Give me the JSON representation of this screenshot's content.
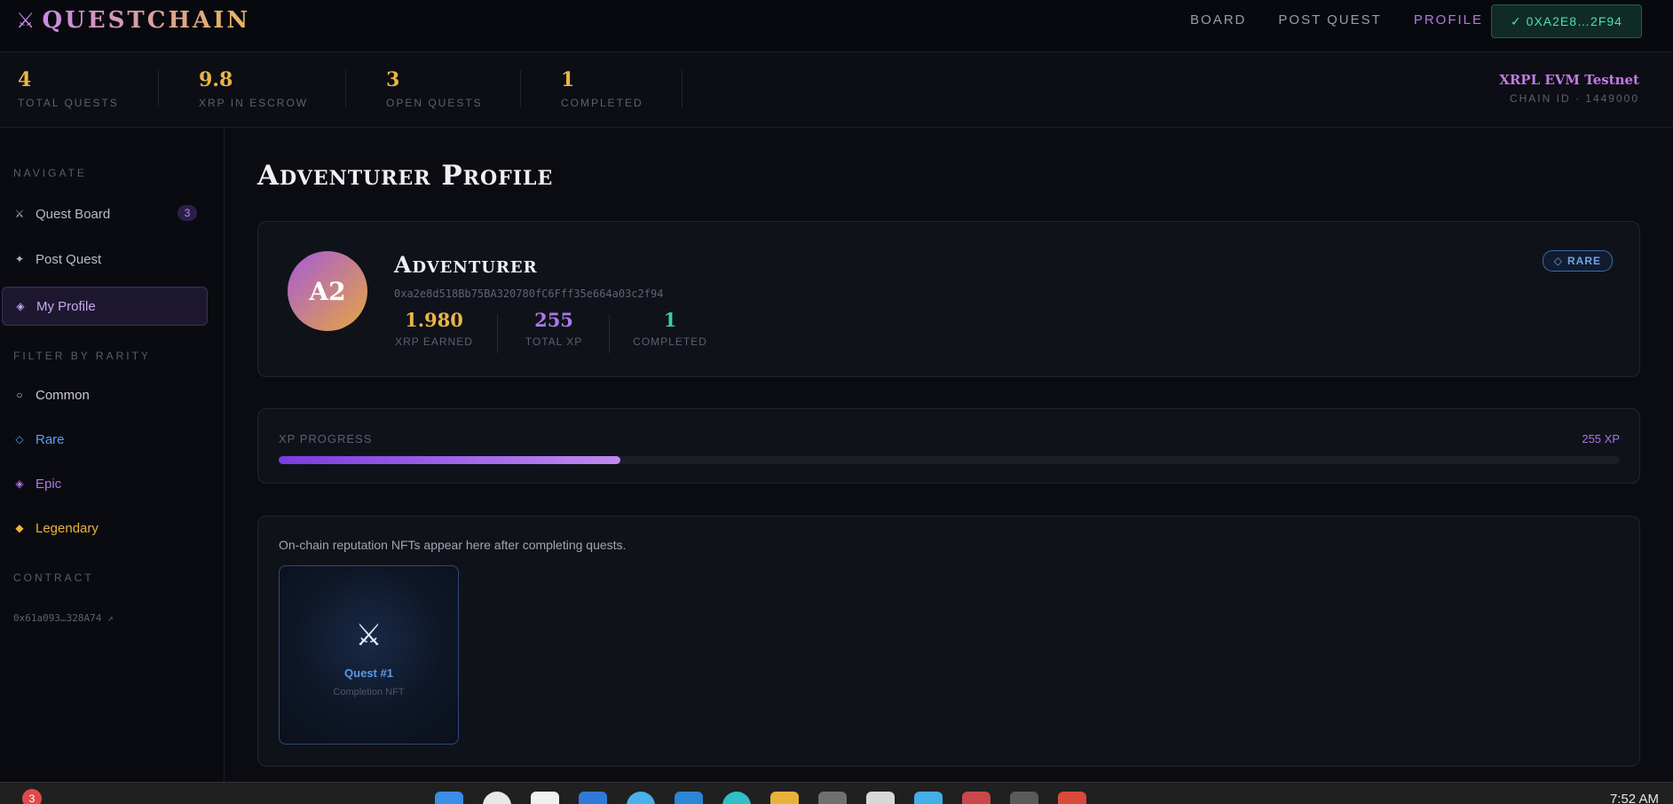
{
  "app": {
    "logo_icon": "⚔",
    "logo_text": "QUESTCHAIN"
  },
  "nav": {
    "links": [
      "BOARD",
      "POST QUEST",
      "PROFILE"
    ],
    "active_link": "PROFILE",
    "wallet": "✓ 0XA2E8…2F94"
  },
  "stats": [
    {
      "value": "4",
      "label": "TOTAL QUESTS"
    },
    {
      "value": "9.8",
      "label": "XRP IN ESCROW"
    },
    {
      "value": "3",
      "label": "OPEN QUESTS"
    },
    {
      "value": "1",
      "label": "COMPLETED"
    }
  ],
  "network": {
    "name": "XRPL EVM Testnet",
    "chain": "CHAIN ID · 1449000"
  },
  "sidebar": {
    "navigate_heading": "NAVIGATE",
    "items": [
      {
        "icon": "⚔",
        "label": "Quest Board",
        "badge": "3"
      },
      {
        "icon": "✦",
        "label": "Post Quest"
      },
      {
        "icon": "◈",
        "label": "My Profile"
      }
    ],
    "rarity_heading": "FILTER BY RARITY",
    "rarities": [
      {
        "icon": "○",
        "label": "Common",
        "color": "#c9cad3"
      },
      {
        "icon": "◇",
        "label": "Rare",
        "color": "#5c9cf0"
      },
      {
        "icon": "◈",
        "label": "Epic",
        "color": "#b276e8"
      },
      {
        "icon": "◆",
        "label": "Legendary",
        "color": "#eab43a"
      }
    ],
    "contract_heading": "CONTRACT",
    "contract": "0x61a093…328A74 ↗"
  },
  "profile": {
    "page_title": "Adventurer Profile",
    "avatar": "A2",
    "name": "Adventurer",
    "address": "0xa2e8d518Bb75BA320780fC6Fff35e664a03c2f94",
    "rarity": "RARE",
    "rarity_icon": "◇",
    "stats": [
      {
        "value": "1.980",
        "label": "XRP EARNED",
        "color": "#e8b647"
      },
      {
        "value": "255",
        "label": "TOTAL XP",
        "color": "#a97ce8"
      },
      {
        "value": "1",
        "label": "COMPLETED",
        "color": "#3fcf9d"
      }
    ]
  },
  "xp": {
    "label": "XP PROGRESS",
    "value": "255 XP",
    "progress_fraction": 0.255
  },
  "nfts": {
    "message": "On-chain reputation NFTs appear here after completing quests.",
    "items": [
      {
        "icon": "⚔",
        "title": "Quest #1",
        "subtitle": "Completion NFT"
      }
    ]
  },
  "taskbar": {
    "notification_count": "3",
    "clock": "7:52 AM"
  }
}
